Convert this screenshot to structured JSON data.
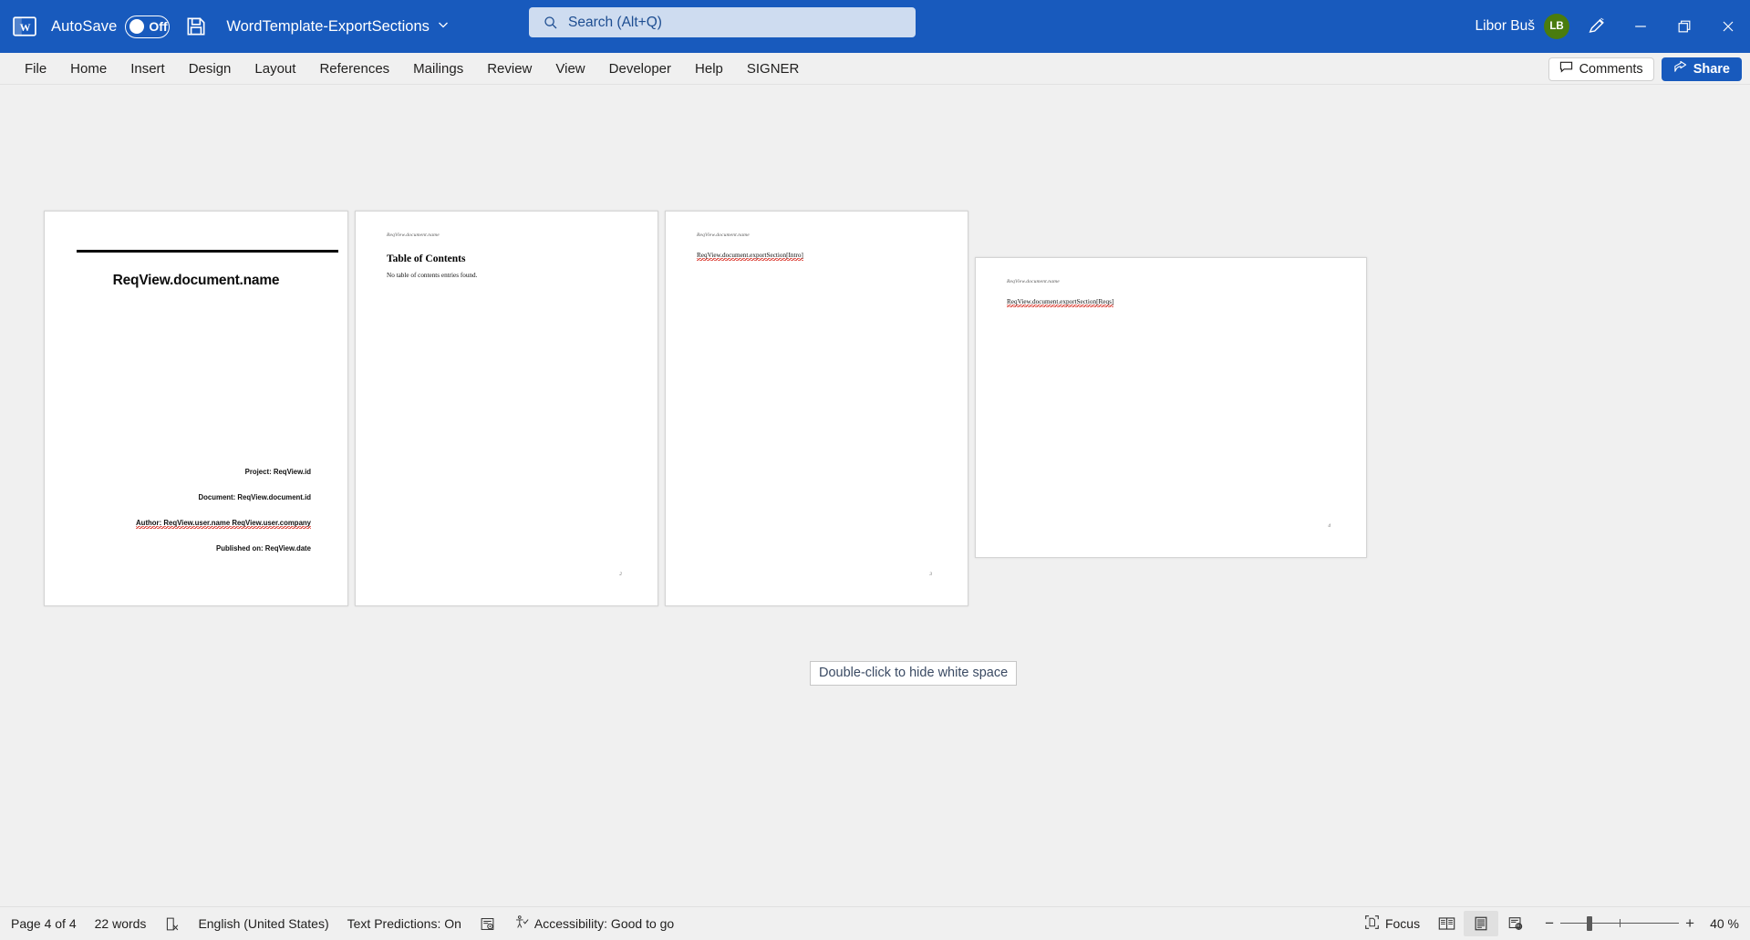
{
  "titlebar": {
    "app_icon": "word-logo-icon",
    "autosave_label": "AutoSave",
    "autosave_state": "Off",
    "save_icon": "save-icon",
    "document_title": "WordTemplate-ExportSections",
    "title_chevron": "⌄",
    "user_name": "Libor Buš",
    "user_initials": "LB",
    "avatar_color": "#4a7c0e",
    "accent_color": "#185abd",
    "minimize_label": "Minimize",
    "restore_label": "Restore Down",
    "close_label": "Close"
  },
  "search": {
    "placeholder": "Search (Alt+Q)",
    "icon": "search-icon"
  },
  "ribbon": {
    "tabs": [
      {
        "label": "File"
      },
      {
        "label": "Home"
      },
      {
        "label": "Insert"
      },
      {
        "label": "Design"
      },
      {
        "label": "Layout"
      },
      {
        "label": "References"
      },
      {
        "label": "Mailings"
      },
      {
        "label": "Review"
      },
      {
        "label": "View"
      },
      {
        "label": "Developer"
      },
      {
        "label": "Help"
      },
      {
        "label": "SIGNER"
      }
    ],
    "comments_label": "Comments",
    "share_label": "Share"
  },
  "document": {
    "white_space_tooltip": "Double-click to hide white space",
    "pages": [
      {
        "kind": "cover",
        "title": "ReqView.document.name",
        "meta": [
          "Project: ReqView.id",
          "Document: ReqView.document.id",
          "Author: ReqView.user.name ReqView.user.company",
          "Published on: ReqView.date"
        ],
        "page_number": ""
      },
      {
        "kind": "toc",
        "header": "ReqView.document.name",
        "heading": "Table of Contents",
        "note": "No table of contents entries found.",
        "page_number": "2"
      },
      {
        "kind": "section",
        "header": "ReqView.document.name",
        "body": "ReqView.document.exportSection[Intro]",
        "page_number": "3"
      },
      {
        "kind": "section",
        "header": "ReqView.document.name",
        "body": "ReqView.document.exportSection[Reqs]",
        "page_number": "4"
      }
    ]
  },
  "statusbar": {
    "page_indicator": "Page 4 of 4",
    "word_count": "22 words",
    "proofing_icon": "spell-check-icon",
    "language": "English (United States)",
    "text_predictions": "Text Predictions: On",
    "display_settings_icon": "display-settings-icon",
    "accessibility": "Accessibility: Good to go",
    "accessibility_icon": "accessibility-icon",
    "focus_label": "Focus",
    "focus_icon": "focus-icon",
    "read_mode_icon": "read-mode-icon",
    "print_layout_icon": "print-layout-icon",
    "web_layout_icon": "web-layout-icon",
    "zoom_out_label": "−",
    "zoom_in_label": "+",
    "zoom_percent": "40 %"
  }
}
